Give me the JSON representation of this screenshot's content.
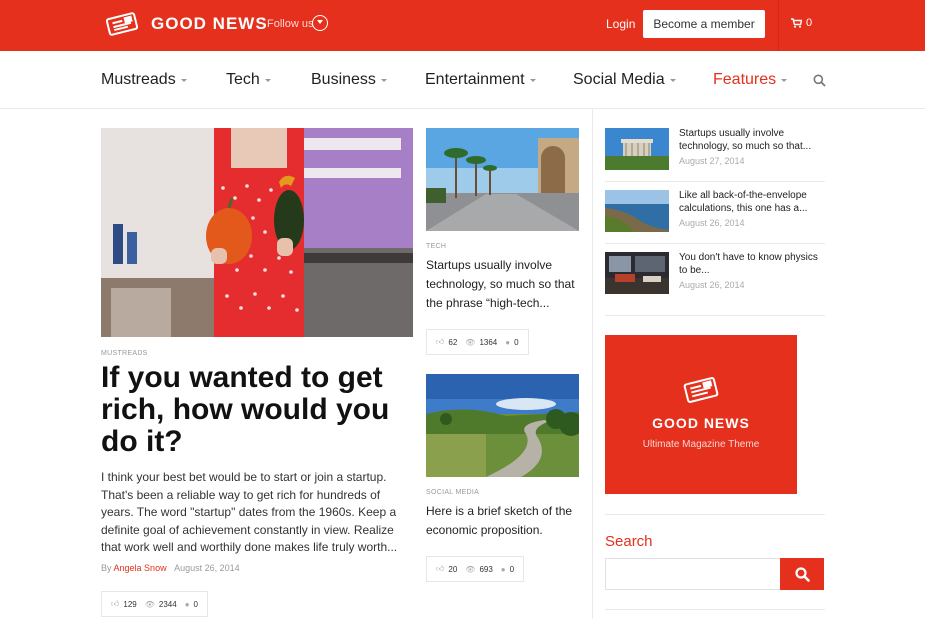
{
  "brand": {
    "name": "GOOD NEWS",
    "follow_label": "Follow us",
    "accent": "#e5301d"
  },
  "topbar": {
    "login": "Login",
    "member_button": "Become a member",
    "cart_count": "0"
  },
  "nav": {
    "items": [
      {
        "label": "Mustreads",
        "active": false
      },
      {
        "label": "Tech",
        "active": false
      },
      {
        "label": "Business",
        "active": false
      },
      {
        "label": "Entertainment",
        "active": false
      },
      {
        "label": "Social Media",
        "active": false
      },
      {
        "label": "Features",
        "active": true
      }
    ],
    "search_icon": "search-icon"
  },
  "featured": {
    "category": "MUSTREADS",
    "title": "If you wanted to get rich, how would you do it?",
    "excerpt": "I think your best bet would be to start or join a startup. That's been a reliable way to get rich for hundreds of years. The word \"startup\" dates from the 1960s. Keep a definite goal of achievement constantly in view. Realize that work well and worthily done makes life truly worth...",
    "by": "By",
    "author": "Angela Snow",
    "date": "August 26, 2014",
    "likes": "129",
    "views": "2344",
    "comments": "0"
  },
  "middle": [
    {
      "category": "TECH",
      "title": "Startups usually involve technology, so much so that the phrase “high-tech...",
      "likes": "62",
      "views": "1364",
      "comments": "0"
    },
    {
      "category": "SOCIAL MEDIA",
      "title": "Here is a brief sketch of the economic proposition.",
      "likes": "20",
      "views": "693",
      "comments": "0"
    }
  ],
  "sidebar": {
    "posts": [
      {
        "title": "Startups usually involve technology, so much so that...",
        "date": "August 27, 2014"
      },
      {
        "title": "Like all back-of-the-envelope calculations, this one has a...",
        "date": "August 26, 2014"
      },
      {
        "title": "You don't have to know physics to be...",
        "date": "August 26, 2014"
      }
    ],
    "ad": {
      "title": "GOOD NEWS",
      "subtitle": "Ultimate Magazine Theme"
    },
    "search": {
      "title": "Search",
      "placeholder": ""
    }
  }
}
